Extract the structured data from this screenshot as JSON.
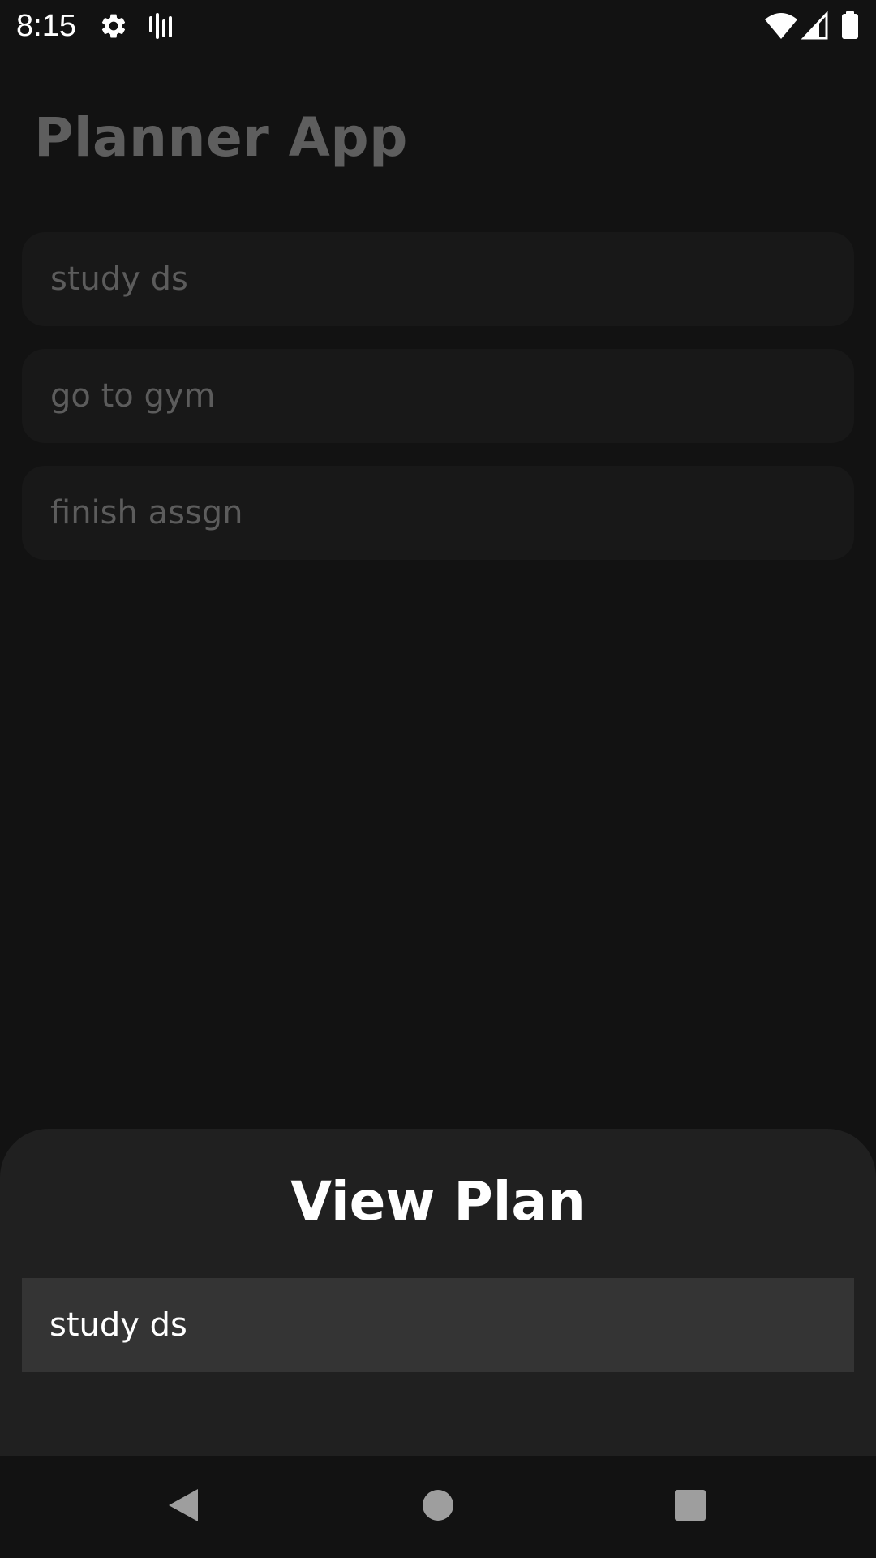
{
  "status_bar": {
    "time": "8:15",
    "icons": [
      "settings-gear-icon",
      "sound-wave-icon",
      "wifi-icon",
      "cell-signal-icon",
      "battery-icon"
    ]
  },
  "app": {
    "title": "Planner App",
    "plans": [
      {
        "label": "study ds"
      },
      {
        "label": "go to gym"
      },
      {
        "label": "finish assgn"
      }
    ]
  },
  "sheet": {
    "title": "View Plan",
    "value": "study ds"
  },
  "nav_bar": {
    "buttons": [
      "back-icon",
      "home-icon",
      "recents-icon"
    ]
  },
  "colors": {
    "background": "#121212",
    "card": "#181818",
    "sheet": "#202020",
    "field": "#343434",
    "text_primary": "#ffffff",
    "text_dimmed": "#5c5c5c"
  }
}
